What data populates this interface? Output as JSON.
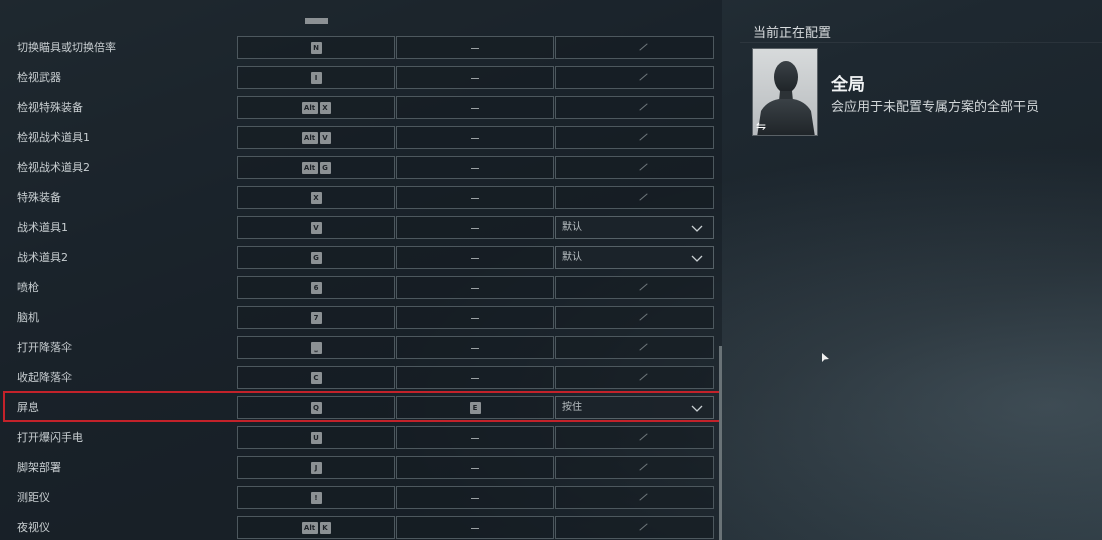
{
  "rows": [
    {
      "label": "切换瞄具或切换倍率",
      "key": [
        "N"
      ],
      "alt": "—",
      "third": "slash"
    },
    {
      "label": "检视武器",
      "key": [
        "I"
      ],
      "alt": "—",
      "third": "slash"
    },
    {
      "label": "检视特殊装备",
      "key": [
        "Alt",
        "X"
      ],
      "alt": "—",
      "third": "slash"
    },
    {
      "label": "检视战术道具1",
      "key": [
        "Alt",
        "V"
      ],
      "alt": "—",
      "third": "slash"
    },
    {
      "label": "检视战术道具2",
      "key": [
        "Alt",
        "G"
      ],
      "alt": "—",
      "third": "slash"
    },
    {
      "label": "特殊装备",
      "key": [
        "X"
      ],
      "alt": "—",
      "third": "slash"
    },
    {
      "label": "战术道具1",
      "key": [
        "V"
      ],
      "alt": "—",
      "third": "dropdown",
      "dropdown": "默认"
    },
    {
      "label": "战术道具2",
      "key": [
        "G"
      ],
      "alt": "—",
      "third": "dropdown",
      "dropdown": "默认"
    },
    {
      "label": "喷枪",
      "key": [
        "6"
      ],
      "alt": "—",
      "third": "slash"
    },
    {
      "label": "脑机",
      "key": [
        "7"
      ],
      "alt": "—",
      "third": "slash"
    },
    {
      "label": "打开降落伞",
      "key": [
        "⎵"
      ],
      "alt": "—",
      "third": "slash"
    },
    {
      "label": "收起降落伞",
      "key": [
        "C"
      ],
      "alt": "—",
      "third": "slash"
    },
    {
      "label": "屏息",
      "key": [
        "Q"
      ],
      "alt": "E",
      "third": "dropdown",
      "dropdown": "按住"
    },
    {
      "label": "打开爆闪手电",
      "key": [
        "U"
      ],
      "alt": "—",
      "third": "slash"
    },
    {
      "label": "脚架部署",
      "key": [
        "J"
      ],
      "alt": "—",
      "third": "slash"
    },
    {
      "label": "测距仪",
      "key": [
        "!"
      ],
      "alt": "—",
      "third": "slash"
    },
    {
      "label": "夜视仪",
      "key": [
        "Alt",
        "K"
      ],
      "alt": "—",
      "third": "slash"
    }
  ],
  "config": {
    "title": "当前正在配置",
    "profile_name": "全局",
    "profile_desc": "会应用于未配置专属方案的全部干员",
    "swap_icon": "⇋"
  },
  "colors": {
    "highlight": "#c3222a",
    "keycap": "#8c9194"
  }
}
